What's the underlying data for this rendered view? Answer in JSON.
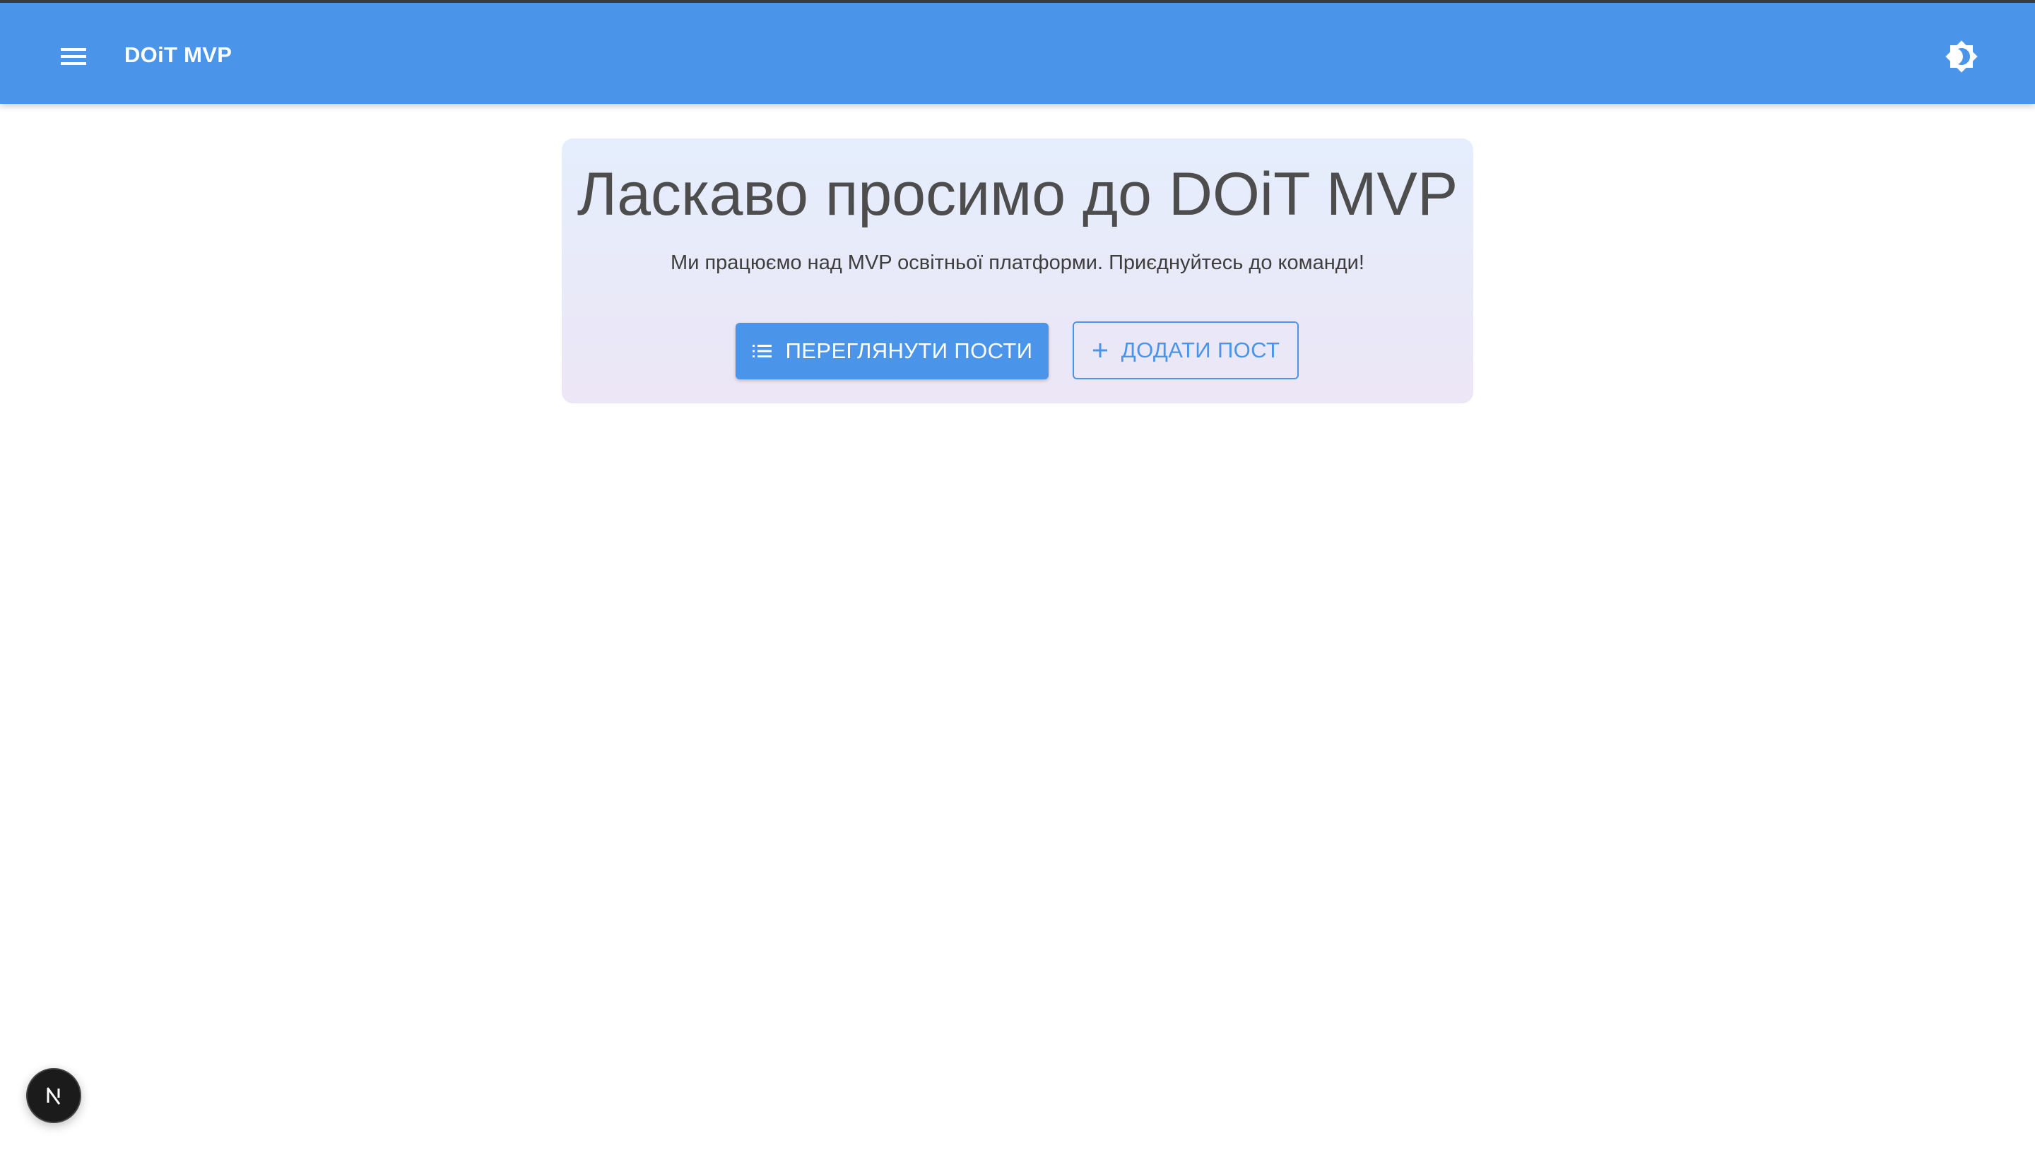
{
  "app_bar": {
    "title": "DOiT MVP",
    "menu_icon": "menu-icon",
    "theme_icon": "brightness-icon",
    "background_color": "#4a95ea"
  },
  "hero": {
    "title": "Ласкаво просимо до DOiT MVP",
    "subtitle": "Ми працюємо над MVP освітньої платформи. Приєднуйтесь до команди!",
    "primary_button": {
      "label": "ПЕРЕГЛЯНУТИ ПОСТИ",
      "icon": "list-icon"
    },
    "secondary_button": {
      "label": "ДОДАТИ ПОСТ",
      "icon": "plus-icon"
    }
  },
  "dev_badge": {
    "letter": "N",
    "icon": "nextjs-icon"
  },
  "colors": {
    "accent": "#4a95ea",
    "text": "#4d4d4d"
  }
}
